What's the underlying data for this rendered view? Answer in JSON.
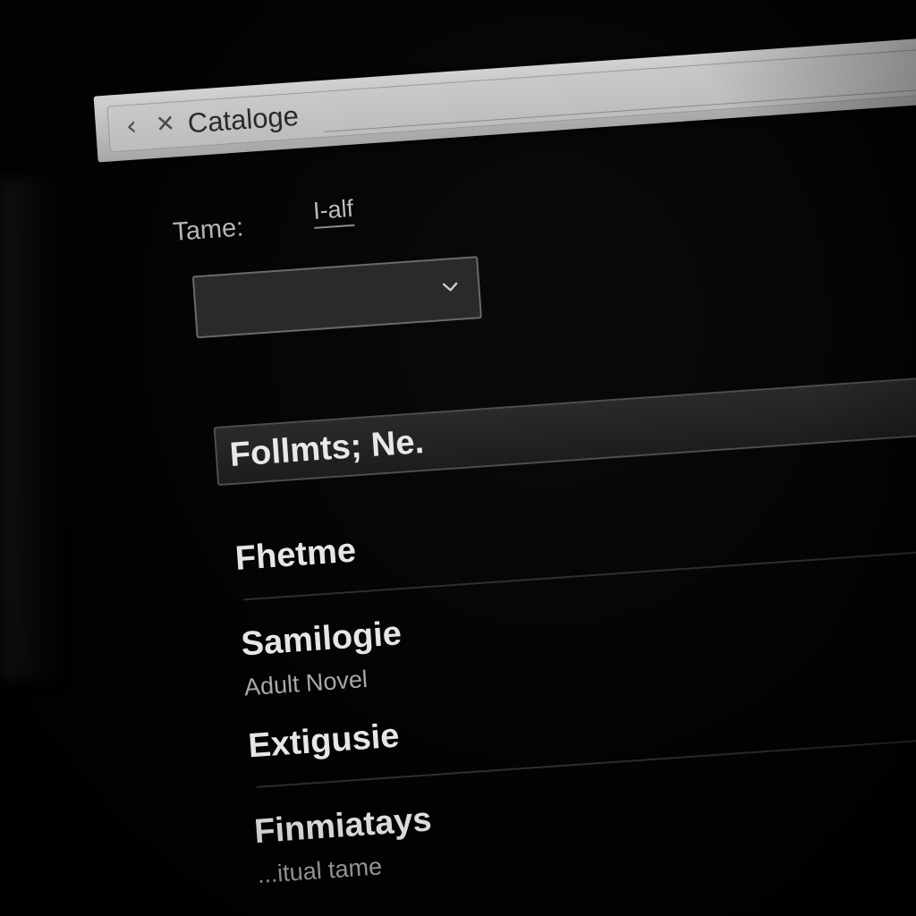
{
  "window": {
    "title": "Cataloge",
    "back_icon": "chevron-left-icon",
    "close_icon": "close-icon"
  },
  "form": {
    "field_label": "Tame:",
    "field_link": "I-alf",
    "select_value": "",
    "select_icon": "chevron-down-icon"
  },
  "section": {
    "header": "Follmts; Ne."
  },
  "items": [
    {
      "title": "Fhetme",
      "subtitle": ""
    },
    {
      "title": "Samilogie",
      "subtitle": "Adult Novel"
    },
    {
      "title": "Extigusie",
      "subtitle": ""
    },
    {
      "title": "Finmiatays",
      "subtitle": "...itual tame"
    }
  ],
  "colors": {
    "background": "#000000",
    "toolbar": "#c4c4c4",
    "text_primary": "#e6e6e6",
    "text_secondary": "#a8a8a8"
  }
}
